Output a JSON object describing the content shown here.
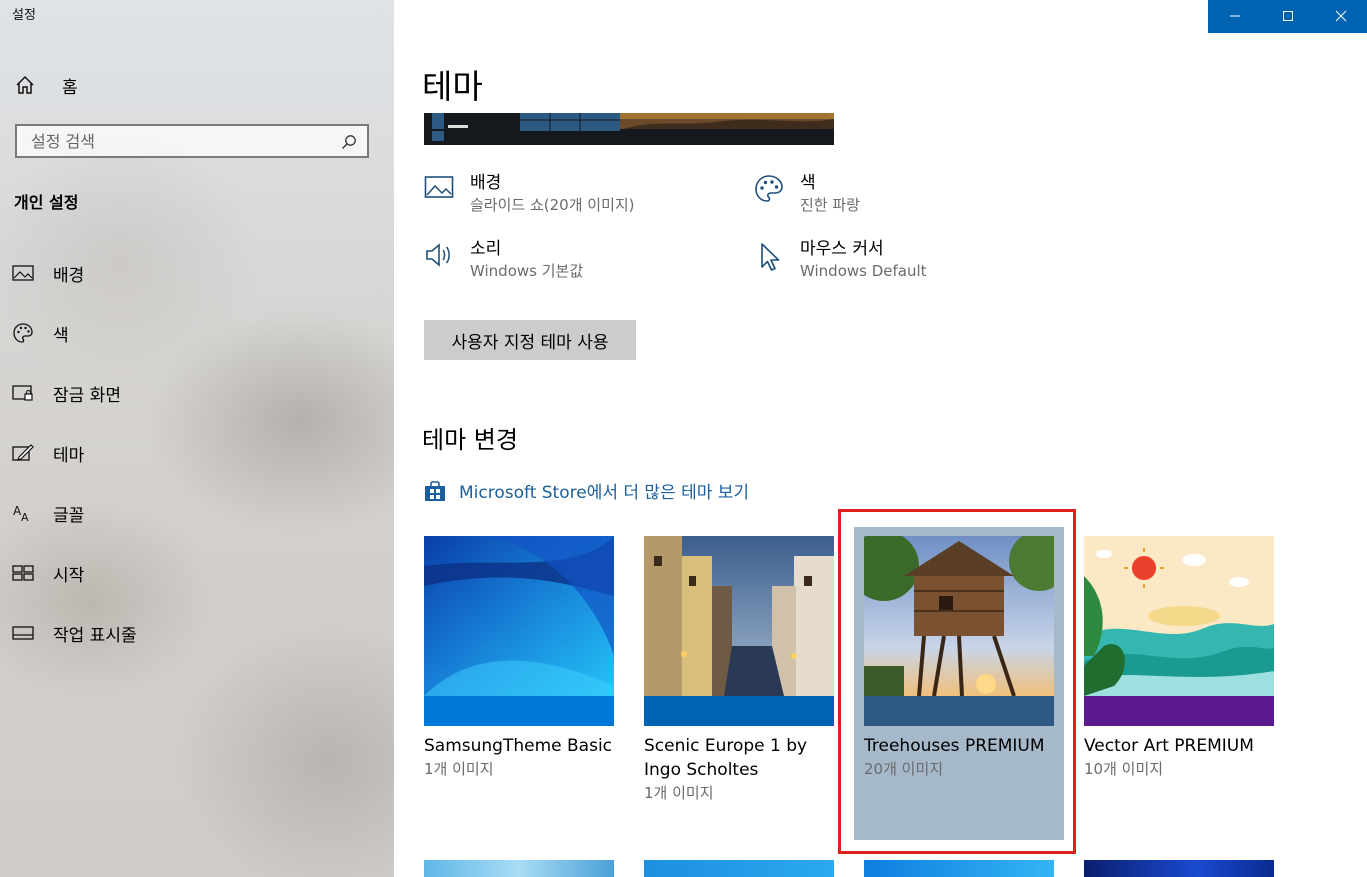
{
  "window": {
    "title": "설정"
  },
  "sidebar": {
    "home_label": "홈",
    "search_placeholder": "설정 검색",
    "section_title": "개인 설정",
    "items": [
      {
        "label": "배경",
        "icon": "image-icon"
      },
      {
        "label": "색",
        "icon": "palette-icon"
      },
      {
        "label": "잠금 화면",
        "icon": "lock-screen-icon"
      },
      {
        "label": "테마",
        "icon": "theme-icon"
      },
      {
        "label": "글꼴",
        "icon": "font-icon"
      },
      {
        "label": "시작",
        "icon": "start-icon"
      },
      {
        "label": "작업 표시줄",
        "icon": "taskbar-icon"
      }
    ]
  },
  "main": {
    "title": "테마",
    "properties": [
      {
        "title": "배경",
        "value": "슬라이드 쇼(20개 이미지)",
        "icon": "image-icon"
      },
      {
        "title": "색",
        "value": "진한 파랑",
        "icon": "palette-icon"
      },
      {
        "title": "소리",
        "value": "Windows 기본값",
        "icon": "speaker-icon"
      },
      {
        "title": "마우스 커서",
        "value": "Windows Default",
        "icon": "cursor-icon"
      }
    ],
    "custom_theme_button": "사용자 지정 테마 사용",
    "change_theme_title": "테마 변경",
    "store_link": "Microsoft Store에서 더 많은 테마 보기",
    "themes": [
      {
        "name": "SamsungTheme Basic",
        "count": "1개 이미지",
        "accent": "#0078d7"
      },
      {
        "name": "Scenic Europe 1 by Ingo Scholtes",
        "count": "1개 이미지",
        "accent": "#0063b1"
      },
      {
        "name": "Treehouses PREMIUM",
        "count": "20개 이미지",
        "accent": "#2d5a83",
        "selected": true
      },
      {
        "name": "Vector Art PREMIUM",
        "count": "10개 이미지",
        "accent": "#5c1a8f"
      }
    ]
  },
  "colors": {
    "accent": "#0063b1",
    "link": "#1b5f9c",
    "selection": "#a6b9cb",
    "highlight": "#e0201e"
  }
}
